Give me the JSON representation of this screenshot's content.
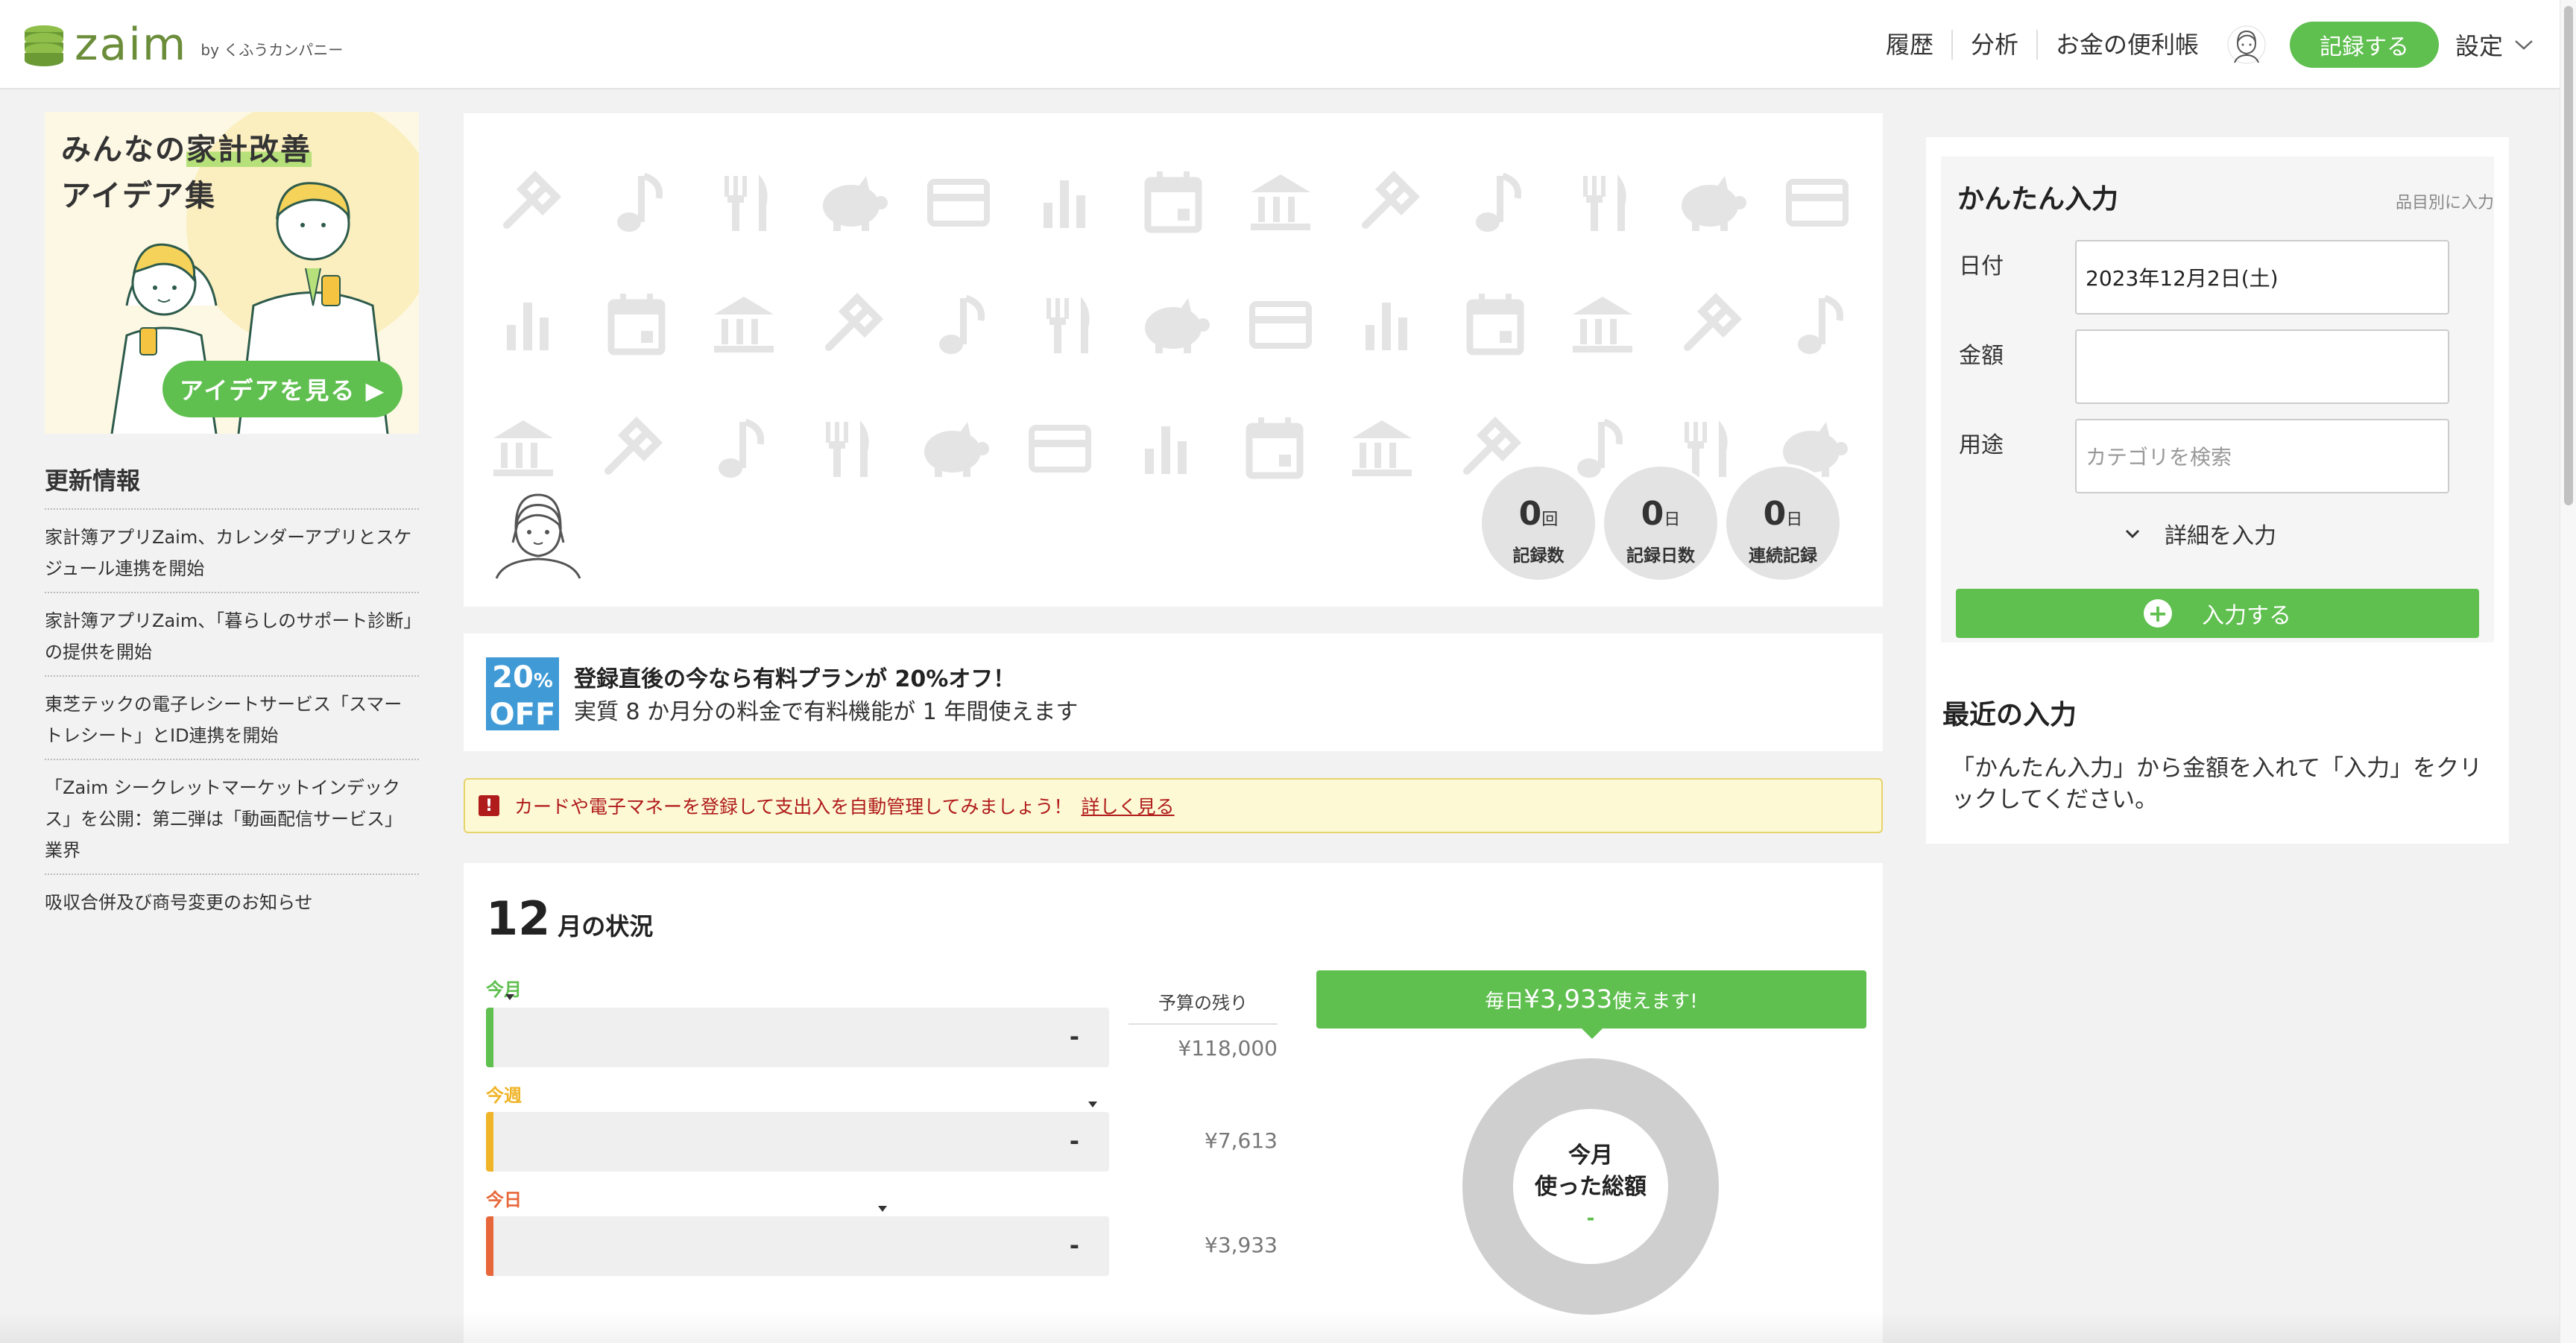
{
  "header": {
    "logo_text": "zaim",
    "logo_by": "by くふうカンパニー",
    "nav": [
      "履歴",
      "分析",
      "お金の便利帳"
    ],
    "record_button": "記録する",
    "settings": "設定"
  },
  "banner": {
    "title_line1_pre": "みんなの",
    "title_line1_hl": "家計改善",
    "title_line2": "アイデア集",
    "button": "アイデアを見る ▶"
  },
  "news": {
    "heading": "更新情報",
    "items": [
      "家計簿アプリZaim、カレンダーアプリとスケジュール連携を開始",
      "家計簿アプリZaim、「暮らしのサポート診断」の提供を開始",
      "東芝テックの電子レシートサービス「スマートレシート」とID連携を開始",
      "「Zaim シークレットマーケットインデックス」を公開：第二弾は「動画配信サービス」業界",
      "吸収合併及び商号変更のお知らせ"
    ]
  },
  "stats": [
    {
      "num": "0",
      "unit": "回",
      "label": "記録数"
    },
    {
      "num": "0",
      "unit": "日",
      "label": "記録日数"
    },
    {
      "num": "0",
      "unit": "日",
      "label": "連続記録"
    }
  ],
  "promo": {
    "badge_top": "20",
    "badge_pct": "%",
    "badge_bottom": "OFF",
    "title": "登録直後の今なら有料プランが 20%オフ！",
    "subtitle": "実質 8 か月分の料金で有料機能が 1 年間使えます"
  },
  "alert": {
    "icon": "!",
    "text": "カードや電子マネーを登録して支出入を自動管理してみましょう！",
    "link": "詳しく見る"
  },
  "status": {
    "month_num": "12",
    "month_label": "月の状況",
    "budget_head": "予算の残り",
    "rows": [
      {
        "label": "今月",
        "value": "-",
        "remaining": "¥118,000",
        "color": "#5fbf4f"
      },
      {
        "label": "今週",
        "value": "-",
        "remaining": "¥7,613",
        "color": "#f0b429"
      },
      {
        "label": "今日",
        "value": "-",
        "remaining": "¥3,933",
        "color": "#e8673a"
      }
    ],
    "daily_pre": "毎日",
    "daily_amount": "¥3,933",
    "daily_post": "使えます!",
    "donut_line1": "今月",
    "donut_line2": "使った総額",
    "donut_value": "-"
  },
  "quick": {
    "title": "かんたん入力",
    "subtitle": "品目別に入力",
    "date_label": "日付",
    "date_value": "2023年12月2日(土)",
    "amount_label": "金額",
    "amount_value": "",
    "category_label": "用途",
    "category_placeholder": "カテゴリを検索",
    "detail_toggle": "詳細を入力",
    "submit": "入力する"
  },
  "recent": {
    "title": "最近の入力",
    "text": "「かんたん入力」から金額を入れて「入力」をクリックしてください。"
  },
  "colors": {
    "accent": "#5fbf4f",
    "logo": "#6b8d3a",
    "promo_blue": "#3f9ad6",
    "alert_red": "#b01b1b"
  }
}
